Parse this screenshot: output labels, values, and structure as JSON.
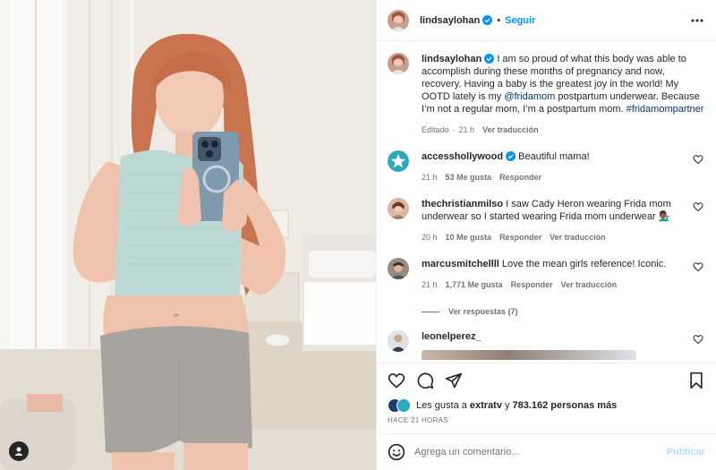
{
  "post": {
    "author": "lindsaylohan",
    "follow_label": "Seguir",
    "caption": {
      "author": "lindsaylohan",
      "text": "I am so proud of what this body was able to accomplish during these months of pregnancy and now, recovery. Having a baby is the greatest joy in the world! My OOTD lately is my ",
      "mention": "@fridamom",
      "text2": " postpartum underwear. Because I’m not a regular mom, I’m a postpartum mom. ",
      "hashtag": "#fridamompartner",
      "edited": "Editado",
      "time": "21 h",
      "translate": "Ver traducción"
    }
  },
  "comments": [
    {
      "user": "accesshollywood",
      "verified": true,
      "text": "Beautiful mama!",
      "time": "21 h",
      "likes": "53 Me gusta",
      "reply": "Responder",
      "translate": ""
    },
    {
      "user": "thechristianmilso",
      "verified": false,
      "text": "I saw Cady Heron wearing Frida mom underwear so I started wearing Frida mom underwear 💁🏾‍♂️",
      "time": "20 h",
      "likes": "10 Me gusta",
      "reply": "Responder",
      "translate": "Ver traducción"
    },
    {
      "user": "marcusmitchellll",
      "verified": false,
      "text": "Love the mean girls reference! Iconic.",
      "time": "21 h",
      "likes": "1,771 Me gusta",
      "reply": "Responder",
      "translate": "Ver traducción"
    }
  ],
  "view_replies": "Ver respuestas (7)",
  "last_comment_user": "leonelperez_",
  "likes_summary": {
    "prefix": "Les gusta a ",
    "user": "extratv",
    "middle": " y ",
    "count": "783.162 personas más"
  },
  "timestamp": "HACE 21 HORAS",
  "composer": {
    "placeholder": "Agrega un comentario...",
    "publish": "Publicar"
  },
  "icons": {
    "heart": "heart-icon",
    "comment": "comment-icon",
    "share": "share-icon",
    "save": "bookmark-icon",
    "emoji": "emoji-icon",
    "more": "more-options-icon",
    "user_tag": "user-tag-icon",
    "verified": "verified-badge-icon"
  },
  "colors": {
    "accent": "#0095f6",
    "verified": "#0095f6",
    "muted": "#737373",
    "text": "#262626"
  }
}
